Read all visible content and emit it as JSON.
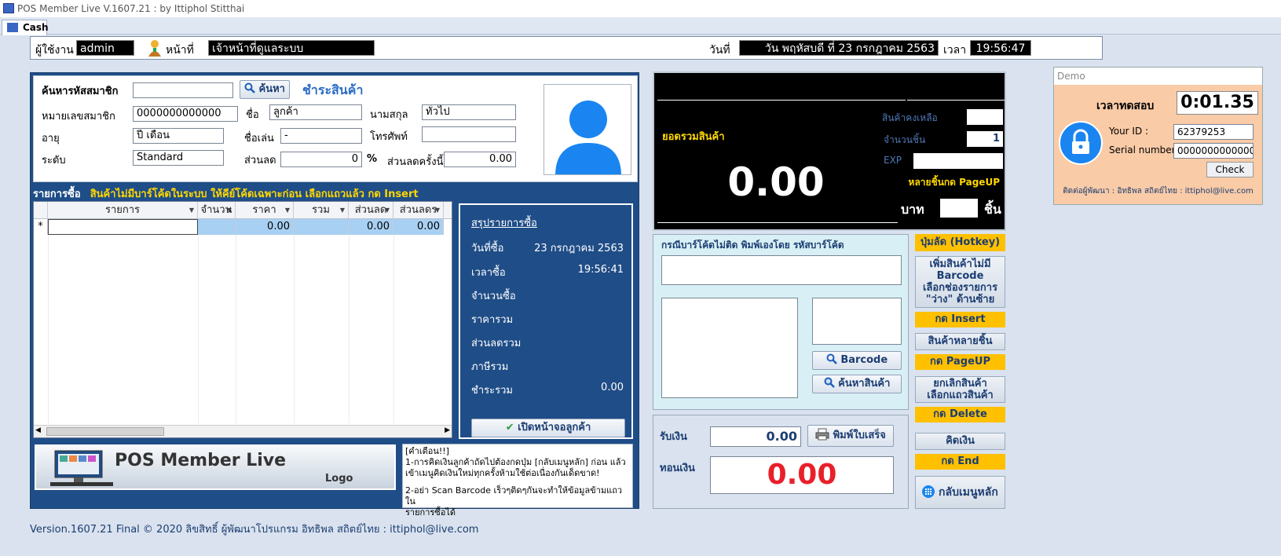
{
  "window": {
    "title": "POS Member Live V.1607.21 : by Ittiphol Stitthai"
  },
  "tabs": [
    {
      "label": "Cash"
    }
  ],
  "header": {
    "user_label": "ผู้ใช้งาน",
    "user_value": "admin",
    "role_label": "หน้าที่",
    "role_value": "เจ้าหน้าที่ดูแลระบบ",
    "date_label": "วันที่",
    "date_value": "วัน พฤหัสบดี ที่ 23 กรกฎาคม 2563",
    "time_label": "เวลา",
    "time_value": "19:56:47"
  },
  "member": {
    "search_label": "ค้นหารหัสสมาชิก",
    "search_value": "",
    "search_button": "ค้นหา",
    "pay_title": "ชำระสินค้า",
    "member_no_label": "หมายเลขสมาชิก",
    "member_no_value": "0000000000000",
    "first_name_label": "ชื่อ",
    "first_name_value": "ลูกค้า",
    "last_name_label": "นามสกุล",
    "last_name_value": "ทั่วไป",
    "age_label": "อายุ",
    "age_value": "ปี   เดือน",
    "nickname_label": "ชื่อเล่น",
    "nickname_value": "-",
    "phone_label": "โทรศัพท์",
    "phone_value": "",
    "level_label": "ระดับ",
    "level_value": "Standard",
    "discount_label": "ส่วนลด",
    "discount_value": "0",
    "percent_sign": "%",
    "discount_once_label": "ส่วนลดครั้งนี้",
    "discount_once_value": "0.00"
  },
  "purchase_list": {
    "title": "รายการซื้อ",
    "warning": "สินค้าไม่มีบาร์โค้ดในระบบ ให้คีย์โค้ดเฉพาะก่อน เลือกแถวแล้ว กด Insert",
    "columns": [
      "รายการ",
      "จำนวน",
      "ราคา",
      "รวม",
      "ส่วนลด",
      "ส่วนลดร"
    ],
    "new_row_marker": "*",
    "row": {
      "item": "",
      "qty": "",
      "price": "0.00",
      "total": "",
      "discount": "0.00",
      "discount2": "0.00"
    }
  },
  "summary": {
    "title": "สรุปรายการซื้อ",
    "rows": [
      {
        "label": "วันที่ซื้อ",
        "value": "23 กรกฎาคม 2563"
      },
      {
        "label": "เวลาซื้อ",
        "value": "19:56:41"
      },
      {
        "label": "จำนวนซื้อ",
        "value": ""
      },
      {
        "label": "ราคารวม",
        "value": ""
      },
      {
        "label": "ส่วนลดรวม",
        "value": ""
      },
      {
        "label": "ภาษีรวม",
        "value": ""
      },
      {
        "label": "ชำระรวม",
        "value": "0.00"
      }
    ],
    "open_button": "เปิดหน้าจอลูกค้า"
  },
  "logo": {
    "brand": "POS Member Live",
    "sub": "Logo"
  },
  "notice": {
    "title": "[คำเตือน!!]",
    "line1": "1-การคิดเงินลูกค้าถัดไปต้องกดปุ่ม [กลับเมนูหลัก] ก่อน แล้ว",
    "line2": "เข้าเมนูคิดเงินใหม่ทุกครั้งห้ามใช้ต่อเนื่องกันเด็ดขาด!",
    "line3": "2-อย่า Scan Barcode เร็วๆติดๆกันจะทำให้ข้อมูลข้ามแถวใน",
    "line4": "รายการซื้อได้"
  },
  "footer": {
    "text": "Version.1607.21 Final © 2020 ลิขสิทธิ์ ผู้พัฒนาโปรแกรม อิทธิพล สถิตย์ไทย : ittiphol@live.com"
  },
  "display": {
    "total_label": "ยอดรวมสินค้า",
    "total_value": "0.00",
    "stock_label": "สินค้าคงเหลือ",
    "stock_value": "",
    "qty_label": "จำนวนชิ้น",
    "qty_value": "1",
    "exp_label": "EXP",
    "exp_value": "",
    "multi_hint": "หลายชิ้นกด PageUP",
    "baht_label": "บาท",
    "pieces_value": "",
    "pieces_label": "ชิ้น"
  },
  "manual": {
    "title": "กรณีบาร์โค้ดไม่ติด พิมพ์เองโดย รหัสบาร์โค้ด",
    "barcode_button": "Barcode",
    "search_button": "ค้นหาสินค้า"
  },
  "payment": {
    "receive_label": "รับเงิน",
    "receive_value": "0.00",
    "print_button": "พิมพ์ใบเสร็จ",
    "change_label": "ทอนเงิน",
    "change_value": "0.00"
  },
  "hotkeys": {
    "title": "ปุ่มลัด (Hotkey)",
    "add_no_barcode_l1": "เพิ่มสินค้าไม่มี",
    "add_no_barcode_l2": "Barcode",
    "add_no_barcode_l3": "เลือกช่องรายการ",
    "add_no_barcode_l4": "\"ว่าง\" ด้านซ้าย",
    "insert_key": "กด Insert",
    "multi_item": "สินค้าหลายชิ้น",
    "pageup_key": "กด PageUP",
    "cancel_l1": "ยกเลิกสินค้า",
    "cancel_l2": "เลือกแถวสินค้า",
    "delete_key": "กด Delete",
    "checkout": "คิดเงิน",
    "end_key": "กด End",
    "back_menu": "กลับเมนูหลัก"
  },
  "demo": {
    "window_title": "Demo",
    "trial_label": "เวลาทดสอบ",
    "trial_value": "0:01.35",
    "id_label": "Your ID :",
    "id_value": "62379253",
    "serial_label": "Serial number",
    "serial_value": "00000000000000",
    "check_button": "Check",
    "contact": "ติดต่อผู้พัฒนา : อิทธิพล สถิตย์ไทย : ittiphol@live.com"
  },
  "colors": {
    "panel_blue": "#1f4d87",
    "hotkey_yellow": "#ffc000",
    "change_red": "#e8202a",
    "demo_bg": "#f9cba7",
    "avatar_blue": "#1a85f0"
  }
}
